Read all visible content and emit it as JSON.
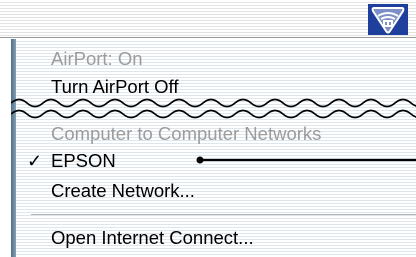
{
  "status_icon": {
    "name": "airport-status-icon"
  },
  "menu": {
    "status": "AirPort: On",
    "toggle_item": "Turn AirPort Off",
    "section_header": "Computer to Computer Networks",
    "check_mark": "✓",
    "selected_network": "EPSON",
    "create_item": "Create Network...",
    "internet_connect_item": "Open Internet Connect..."
  }
}
